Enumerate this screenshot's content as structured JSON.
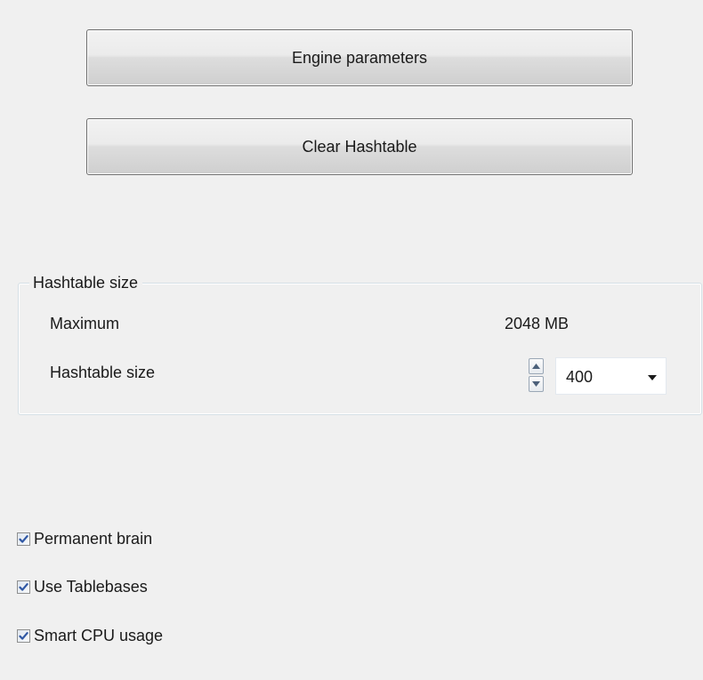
{
  "buttons": {
    "engine_parameters": "Engine parameters",
    "clear_hashtable": "Clear Hashtable"
  },
  "hashtable_group": {
    "title": "Hashtable size",
    "maximum_label": "Maximum",
    "maximum_value": "2048 MB",
    "size_label": "Hashtable size",
    "size_value": "400"
  },
  "options": {
    "permanent_brain": {
      "label": "Permanent brain",
      "checked": true
    },
    "use_tablebases": {
      "label": "Use Tablebases",
      "checked": true
    },
    "smart_cpu_usage": {
      "label": "Smart CPU usage",
      "checked": true
    }
  },
  "icons": {
    "spin_up": "spin-up-arrow-icon",
    "spin_down": "spin-down-arrow-icon",
    "dropdown": "chevron-down-icon",
    "check": "checkmark-icon"
  },
  "colors": {
    "background": "#f0f0f0",
    "check_blue": "#2f57a4",
    "group_border": "#d5dfe5"
  }
}
